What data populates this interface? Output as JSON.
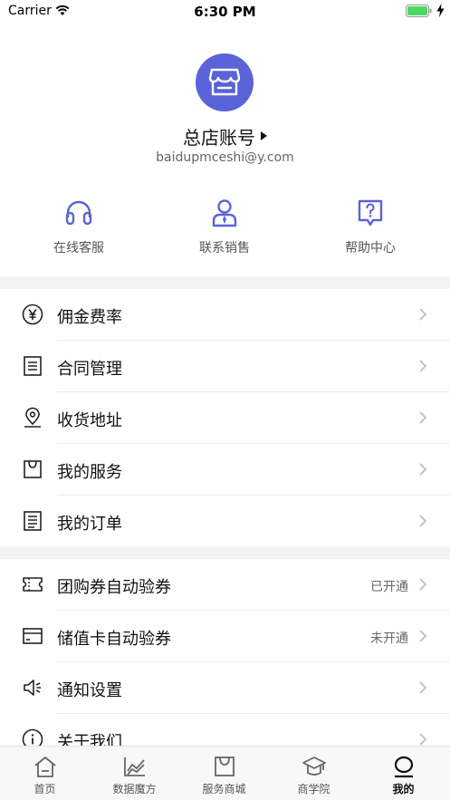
{
  "status_bar": {
    "carrier": "Carrier",
    "time": "6:30 PM"
  },
  "profile": {
    "avatar_icon": "storefront-icon",
    "account_name": "总店账号",
    "email": "baidupmceshi@y.com"
  },
  "quick_links": [
    {
      "label": "在线客服",
      "icon": "headphones-icon"
    },
    {
      "label": "联系销售",
      "icon": "salesperson-icon"
    },
    {
      "label": "帮助中心",
      "icon": "help-bubble-icon"
    }
  ],
  "menu_group_1": [
    {
      "label": "佣金费率",
      "icon": "yen-icon"
    },
    {
      "label": "合同管理",
      "icon": "contract-icon"
    },
    {
      "label": "收货地址",
      "icon": "location-pin-icon"
    },
    {
      "label": "我的服务",
      "icon": "bag-icon"
    },
    {
      "label": "我的订单",
      "icon": "order-list-icon"
    }
  ],
  "menu_group_2": [
    {
      "label": "团购券自动验券",
      "status": "已开通",
      "icon": "ticket-icon"
    },
    {
      "label": "储值卡自动验券",
      "status": "未开通",
      "icon": "card-icon"
    },
    {
      "label": "通知设置",
      "status": "",
      "icon": "speaker-icon"
    },
    {
      "label": "关于我们",
      "status": "",
      "icon": "info-icon"
    }
  ],
  "tab_bar": [
    {
      "label": "首页",
      "icon": "home-icon"
    },
    {
      "label": "数据魔方",
      "icon": "data-chart-icon"
    },
    {
      "label": "服务商城",
      "icon": "shop-bag-icon"
    },
    {
      "label": "商学院",
      "icon": "academy-icon"
    },
    {
      "label": "我的",
      "icon": "profile-icon",
      "active": true
    }
  ],
  "colors": {
    "accent": "#5a63d8",
    "section_gap": "#f3f3f5",
    "battery_green": "#4cd964"
  }
}
